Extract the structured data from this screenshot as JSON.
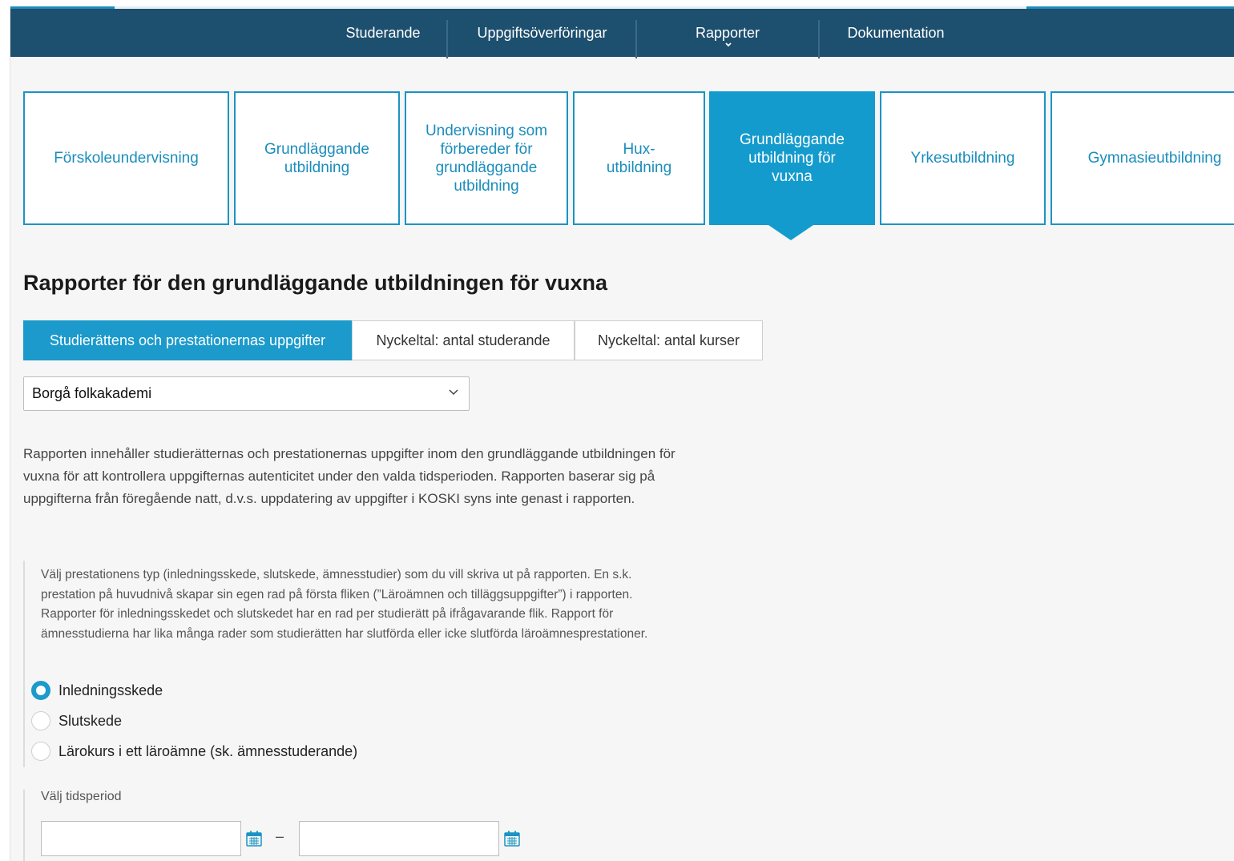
{
  "nav": {
    "items": [
      "Studerande",
      "Uppgiftsöverföringar",
      "Rapporter",
      "Dokumentation"
    ]
  },
  "edu_tabs": [
    "Förskoleundervisning",
    "Grundläggande utbildning",
    "Undervisning som förbereder för grundläggande utbildning",
    "Hux-utbildning",
    "Grundläggande utbildning för vuxna",
    "Yrkesutbildning",
    "Gymnasieutbildning"
  ],
  "page_title": "Rapporter för den grundläggande utbildningen för vuxna",
  "report_tabs": [
    "Studierättens och prestationernas uppgifter",
    "Nyckeltal: antal studerande",
    "Nyckeltal: antal kurser"
  ],
  "organization_select": {
    "value": "Borgå folkakademi"
  },
  "description": "Rapporten innehåller studierätternas och prestationernas uppgifter inom den grundläggande utbildningen för vuxna för att kontrollera uppgifternas autenticitet under den valda tidsperioden. Rapporten baserar sig på uppgifterna från föregående natt, d.v.s. uppdatering av uppgifter i KOSKI syns inte genast i rapporten.",
  "prestation_help": "Välj prestationens typ (inledningsskede, slutskede, ämnesstudier) som du vill skriva ut på rapporten. En s.k. prestation på huvudnivå skapar sin egen rad på första fliken (”Läroämnen och tilläggsuppgifter”) i rapporten. Rapporter för inledningsskedet och slutskedet har en rad per studierätt på ifrågavarande flik. Rapport för ämnesstudierna har lika många rader som studierätten har slutförda eller icke slutförda läroämnesprestationer.",
  "radio_options": [
    "Inledningsskede",
    "Slutskede",
    "Lärokurs i ett läroämne (sk. ämnesstuderande)"
  ],
  "selected_radio": "Inledningsskede",
  "period_label": "Välj tidsperiod",
  "date_separator": "–",
  "colors": {
    "nav_bg": "#1d4f6f",
    "accent": "#149bcd"
  }
}
